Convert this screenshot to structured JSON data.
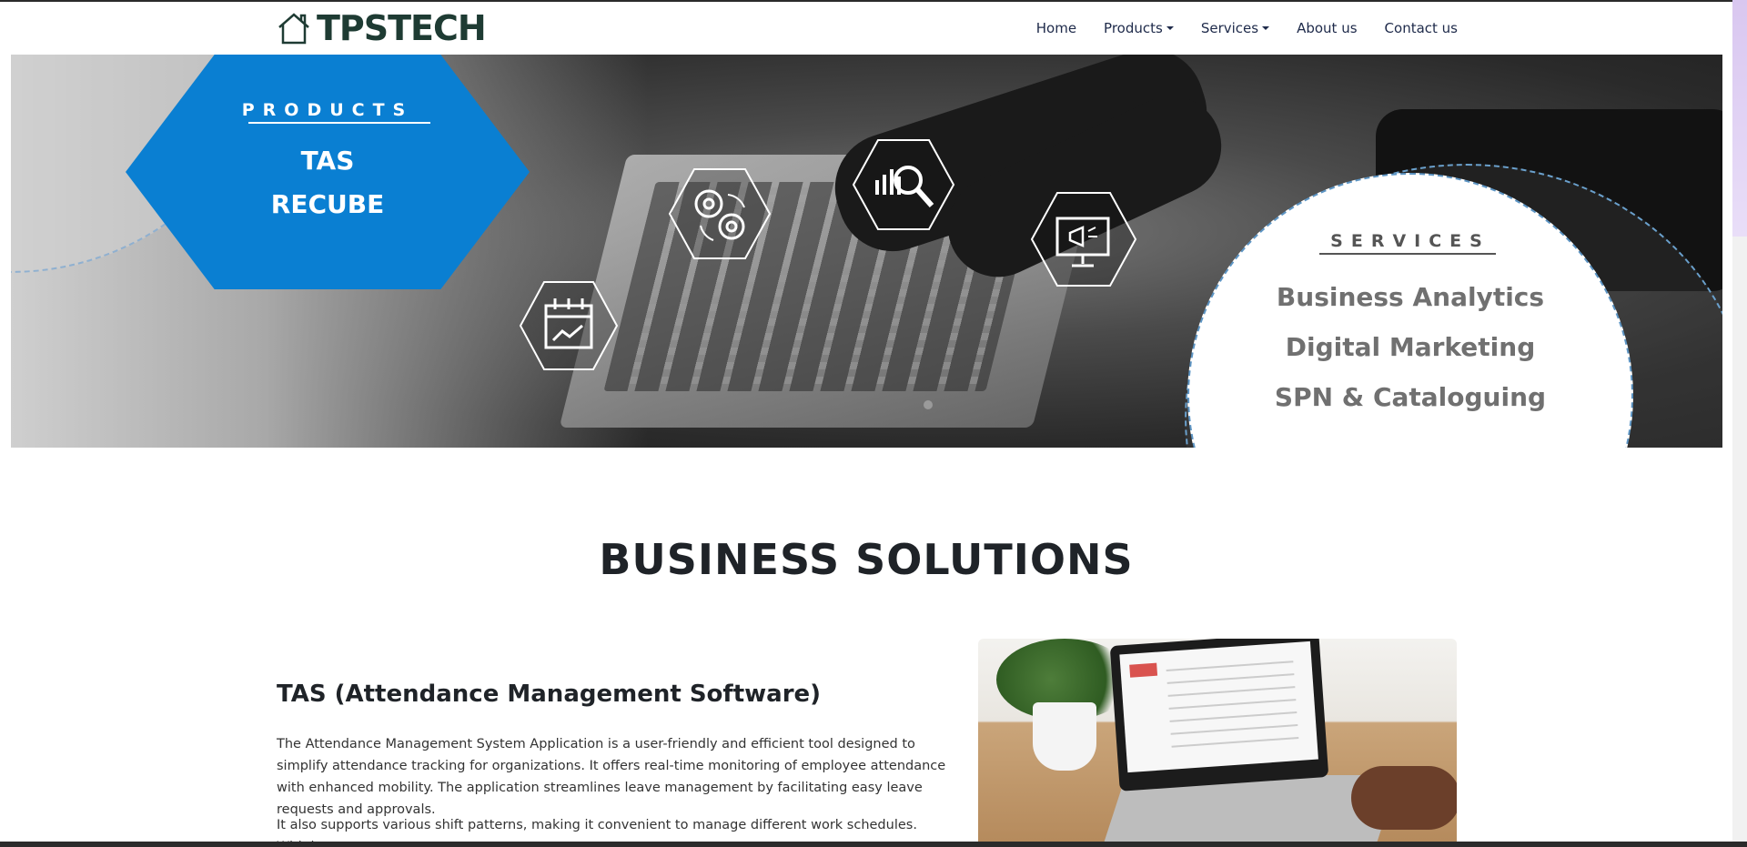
{
  "navbar": {
    "brand": "TPSTECH",
    "items": [
      {
        "label": "Home",
        "dropdown": false
      },
      {
        "label": "Products",
        "dropdown": true
      },
      {
        "label": "Services",
        "dropdown": true
      },
      {
        "label": "About us",
        "dropdown": false
      },
      {
        "label": "Contact us",
        "dropdown": false
      }
    ]
  },
  "hero": {
    "products": {
      "heading": "PRODUCTS",
      "items": [
        "TAS",
        "RECUBE"
      ]
    },
    "services": {
      "heading": "SERVICES",
      "items": [
        "Business Analytics",
        "Digital Marketing",
        "SPN & Cataloguing"
      ]
    },
    "icons": [
      "calendar-chart-icon",
      "gears-icon",
      "analytics-search-icon",
      "monitor-megaphone-icon"
    ]
  },
  "section": {
    "title": "BUSINESS SOLUTIONS",
    "card": {
      "title": "TAS (Attendance Management Software)",
      "paragraph1": "The Attendance Management System Application is a user-friendly and efficient tool designed to simplify attendance tracking for organizations. It offers real-time monitoring of employee attendance with enhanced mobility. The application streamlines leave management by facilitating easy leave requests and approvals.",
      "paragraph2": "It also supports various shift patterns, making it convenient to manage different work schedules. With its"
    }
  },
  "colors": {
    "brand": "#1e3b33",
    "accent_blue": "#0a7fd2",
    "nav_text": "#1e2a4a"
  }
}
